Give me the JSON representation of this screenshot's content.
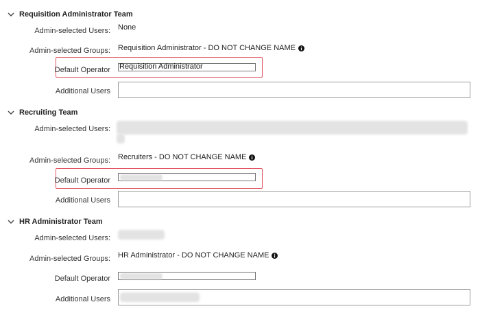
{
  "sections": [
    {
      "title": "Requisition Administrator Team",
      "admin_users_label": "Admin-selected Users:",
      "admin_users_value": "None",
      "admin_groups_label": "Admin-selected Groups:",
      "admin_groups_value": "Requisition Administrator - DO NOT CHANGE NAME",
      "default_operator_label": "Default Operator",
      "default_operator_value": "Requisition Administrator",
      "additional_users_label": "Additional Users"
    },
    {
      "title": "Recruiting Team",
      "admin_users_label": "Admin-selected Users:",
      "admin_groups_label": "Admin-selected Groups:",
      "admin_groups_value": "Recruiters - DO NOT CHANGE NAME",
      "default_operator_label": "Default Operator",
      "additional_users_label": "Additional Users"
    },
    {
      "title": "HR Administrator Team",
      "admin_users_label": "Admin-selected Users:",
      "admin_groups_label": "Admin-selected Groups:",
      "admin_groups_value": "HR Administrator - DO NOT CHANGE NAME",
      "default_operator_label": "Default Operator",
      "additional_users_label": "Additional Users"
    }
  ],
  "icons": {
    "collapse": "chevron-down-icon",
    "info": "info-icon"
  },
  "colors": {
    "highlight": "#e0535f"
  }
}
